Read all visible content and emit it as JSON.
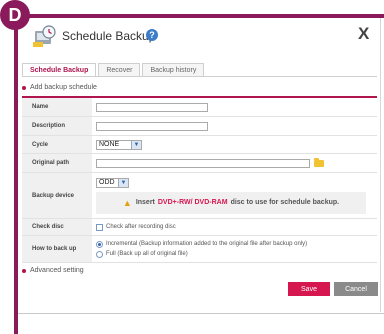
{
  "badge": "D",
  "dialog": {
    "title": "Schedule Backup",
    "help_icon": "?",
    "close": "X"
  },
  "tabs": [
    {
      "label": "Schedule Backup",
      "active": true
    },
    {
      "label": "Recover",
      "active": false
    },
    {
      "label": "Backup history",
      "active": false
    }
  ],
  "sections": {
    "add": "Add backup schedule",
    "advanced": "Advanced setting"
  },
  "form": {
    "name_label": "Name",
    "name_value": "",
    "description_label": "Description",
    "description_value": "",
    "cycle_label": "Cycle",
    "cycle_value": "NONE",
    "original_path_label": "Original path",
    "original_path_value": "",
    "backup_device_label": "Backup device",
    "backup_device_value": "ODD",
    "notice_pre": "Insert",
    "notice_media": "DVD+-RW/ DVD-RAM",
    "notice_post": "disc to use for schedule backup.",
    "check_disc_label": "Check disc",
    "check_disc_option": "Check after recording disc",
    "check_disc_checked": false,
    "how_label": "How to back up",
    "option_incremental": "Incremental (Backup information added to the original file after backup only)",
    "option_full": "Full (Back up all of original file)",
    "selected_option": "incremental"
  },
  "buttons": {
    "save": "Save",
    "cancel": "Cancel"
  },
  "colors": {
    "accent": "#b0154e",
    "frame": "#8a1a5c",
    "save": "#d6174f",
    "cancel": "#8a8a8a"
  }
}
